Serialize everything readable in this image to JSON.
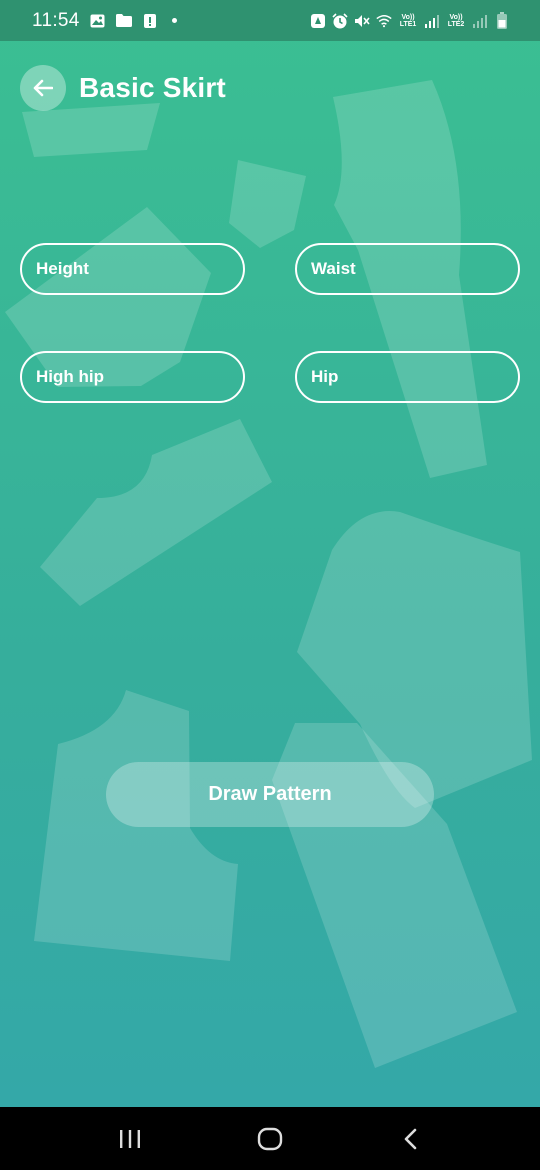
{
  "status_bar": {
    "time": "11:54",
    "lte1_label": "Vo)) LTE1",
    "lte2_label": "Vo)) LTE2",
    "left_icons": [
      "gallery-icon",
      "folder-icon",
      "alert-icon"
    ],
    "right_icons": [
      "battery-saver-icon",
      "alarm-icon",
      "mute-icon",
      "wifi-icon",
      "signal-icon",
      "battery-icon"
    ]
  },
  "header": {
    "title": "Basic Skirt",
    "back_icon": "arrow-left-icon"
  },
  "form": {
    "height_placeholder": "Height",
    "waist_placeholder": "Waist",
    "high_hip_placeholder": "High hip",
    "hip_placeholder": "Hip"
  },
  "actions": {
    "draw_label": "Draw Pattern"
  },
  "nav_bar": {
    "icons": [
      "recent-apps-icon",
      "home-icon",
      "back-icon"
    ]
  },
  "colors": {
    "accent_top": "#3bbf92",
    "accent_bottom": "#34a8a8",
    "status_bar": "#2f9270"
  }
}
